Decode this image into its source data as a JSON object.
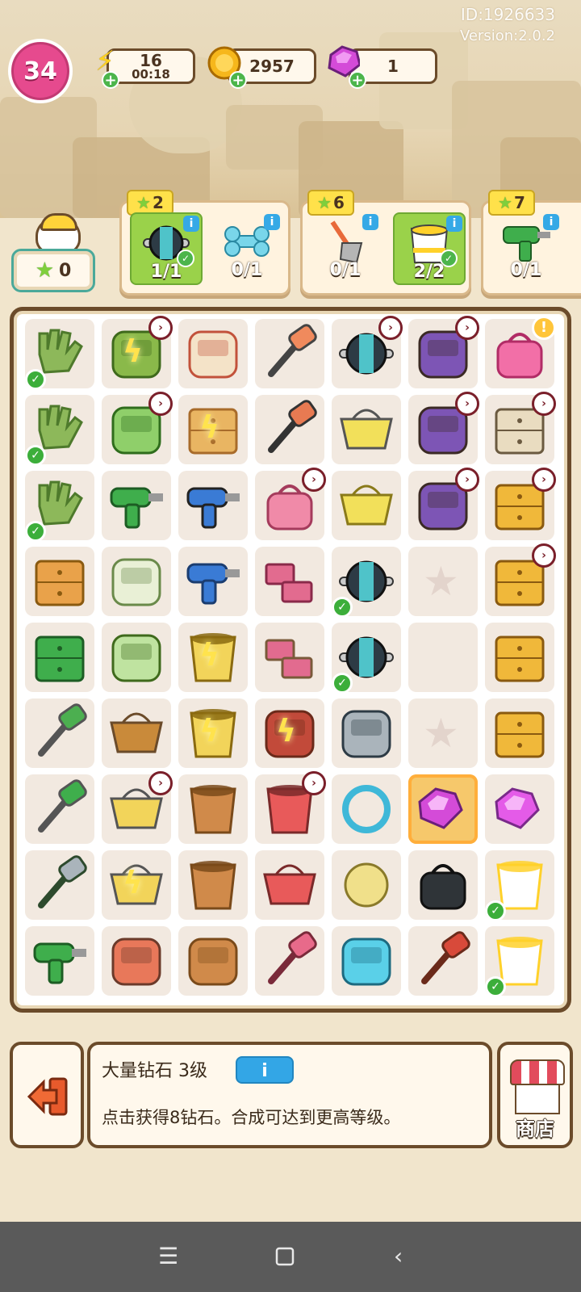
{
  "account": {
    "id_text": "ID:1926633",
    "version_text": "Version:2.0.2"
  },
  "player": {
    "level": "34"
  },
  "resources": {
    "energy": {
      "icon": "lightning-icon",
      "value": "16",
      "timer": "00:18"
    },
    "coins": {
      "icon": "coin-icon",
      "value": "2957"
    },
    "gems": {
      "icon": "gem-icon",
      "value": "1"
    }
  },
  "helper": {
    "stars": "0"
  },
  "orders": [
    {
      "stars": "2",
      "slots": [
        {
          "icon": "ab-roller-icon",
          "count": "1/1",
          "done": true
        },
        {
          "icon": "bone-toy-icon",
          "count": "0/1",
          "done": false
        }
      ]
    },
    {
      "stars": "6",
      "slots": [
        {
          "icon": "shovel-icon",
          "count": "0/1",
          "done": false
        },
        {
          "icon": "paint-bucket-icon",
          "count": "2/2",
          "done": true
        }
      ]
    },
    {
      "stars": "7",
      "slots": [
        {
          "icon": "power-drill-icon",
          "count": "0/1",
          "done": false
        }
      ]
    }
  ],
  "board": {
    "columns": 7,
    "cells": [
      {
        "item": "work-gloves-icon",
        "check": true
      },
      {
        "item": "laptop-icon",
        "clock": true,
        "spark": true
      },
      {
        "item": "paint-can-icon"
      },
      {
        "item": "rubber-mallet-icon"
      },
      {
        "item": "ab-roller-cart-icon",
        "clock": true
      },
      {
        "item": "cargo-pile-icon",
        "clock": true
      },
      {
        "item": "pink-backpack-icon",
        "alert": true
      },
      {
        "item": "work-gloves-icon",
        "check": true
      },
      {
        "item": "retro-tv-icon",
        "clock": true
      },
      {
        "item": "paint-box-icon",
        "spark": true
      },
      {
        "item": "utility-knife-icon"
      },
      {
        "item": "basket-dumbbell-icon"
      },
      {
        "item": "cargo-pile-icon",
        "clock": true
      },
      {
        "item": "drawer-cabinet-icon",
        "clock": true
      },
      {
        "item": "work-gloves-icon",
        "check": true
      },
      {
        "item": "megaphone-icon"
      },
      {
        "item": "hair-dryer-icon"
      },
      {
        "item": "pink-handbag-icon",
        "clock": true
      },
      {
        "item": "open-basket-icon"
      },
      {
        "item": "cargo-pile-icon",
        "clock": true
      },
      {
        "item": "wooden-cabinet-icon",
        "clock": true
      },
      {
        "item": "cardboard-box-icon"
      },
      {
        "item": "magazine-icon"
      },
      {
        "item": "blue-fan-icon"
      },
      {
        "item": "pink-bricks-icon"
      },
      {
        "item": "ab-roller-icon",
        "check": true
      },
      {
        "item": "empty-slot-icon",
        "ghost": true
      },
      {
        "item": "plant-cabinet-icon",
        "clock": true
      },
      {
        "item": "green-suitcase-icon"
      },
      {
        "item": "poster-icon"
      },
      {
        "item": "sprout-cup-icon",
        "spark": true
      },
      {
        "item": "brick-pallet-icon"
      },
      {
        "item": "ab-roller-icon",
        "check": true
      },
      {
        "item": "empty-slot-icon"
      },
      {
        "item": "small-drawer-icon"
      },
      {
        "item": "hacksaw-icon"
      },
      {
        "item": "wicker-basket-icon"
      },
      {
        "item": "water-cup-icon",
        "spark": true
      },
      {
        "item": "wheelbarrow-icon",
        "spark": true
      },
      {
        "item": "hand-gripper-icon"
      },
      {
        "item": "empty-slot-icon",
        "ghost": true
      },
      {
        "item": "folded-box-icon"
      },
      {
        "item": "pliers-icon"
      },
      {
        "item": "shopping-cart-icon",
        "clock": true
      },
      {
        "item": "broken-pot-icon"
      },
      {
        "item": "tool-bucket-icon",
        "clock": true
      },
      {
        "item": "jump-ring-icon"
      },
      {
        "item": "gem-pile-icon",
        "selected": true
      },
      {
        "item": "gems-icon"
      },
      {
        "item": "pipe-wrench-icon"
      },
      {
        "item": "loaded-cart-icon",
        "spark": true
      },
      {
        "item": "clay-pot-icon"
      },
      {
        "item": "tool-basket-icon"
      },
      {
        "item": "yarn-ball-icon"
      },
      {
        "item": "black-bag-icon"
      },
      {
        "item": "paint-bucket-icon",
        "check": true
      },
      {
        "item": "power-drill-icon"
      },
      {
        "item": "clay-roller-icon"
      },
      {
        "item": "clay-chunk-icon"
      },
      {
        "item": "dustpan-icon"
      },
      {
        "item": "blue-ribbon-icon"
      },
      {
        "item": "keys-icon"
      },
      {
        "item": "paint-bucket-icon",
        "check": true
      }
    ]
  },
  "info_panel": {
    "title": "大量钻石 3级",
    "info_button": "i",
    "description": "点击获得8钻石。合成可达到更高等级。"
  },
  "shop": {
    "label": "商店"
  }
}
